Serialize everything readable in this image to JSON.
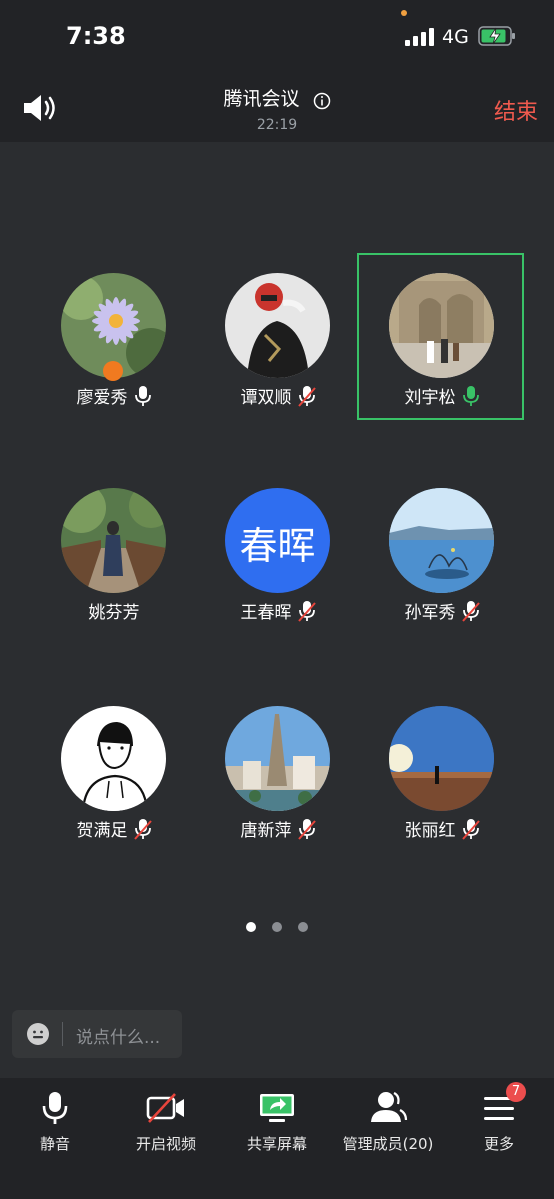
{
  "status_bar": {
    "time": "7:38",
    "network": "4G"
  },
  "header": {
    "title": "腾讯会议",
    "duration": "22:19",
    "end_label": "结束"
  },
  "participants": [
    {
      "name": "廖爱秀",
      "mic": "on",
      "host": true
    },
    {
      "name": "谭双顺",
      "mic": "muted"
    },
    {
      "name": "刘宇松",
      "mic": "speaking",
      "active_speaker": true
    },
    {
      "name": "姚芬芳",
      "mic": "none"
    },
    {
      "name": "王春晖",
      "mic": "muted",
      "avatar_text": "春晖",
      "avatar_color": "#2f6ef0"
    },
    {
      "name": "孙军秀",
      "mic": "muted"
    },
    {
      "name": "贺满足",
      "mic": "muted"
    },
    {
      "name": "唐新萍",
      "mic": "muted"
    },
    {
      "name": "张丽红",
      "mic": "muted"
    }
  ],
  "pager": {
    "pages": 3,
    "current": 1
  },
  "chat": {
    "placeholder": "说点什么..."
  },
  "toolbar": {
    "mute_label": "静音",
    "video_label": "开启视频",
    "share_label": "共享屏幕",
    "members_label": "管理成员(20)",
    "more_label": "更多",
    "more_badge": "7"
  },
  "colors": {
    "end": "#f05a4e",
    "speaking": "#39c267",
    "host": "#f07a20",
    "badge": "#ec4d4d"
  }
}
